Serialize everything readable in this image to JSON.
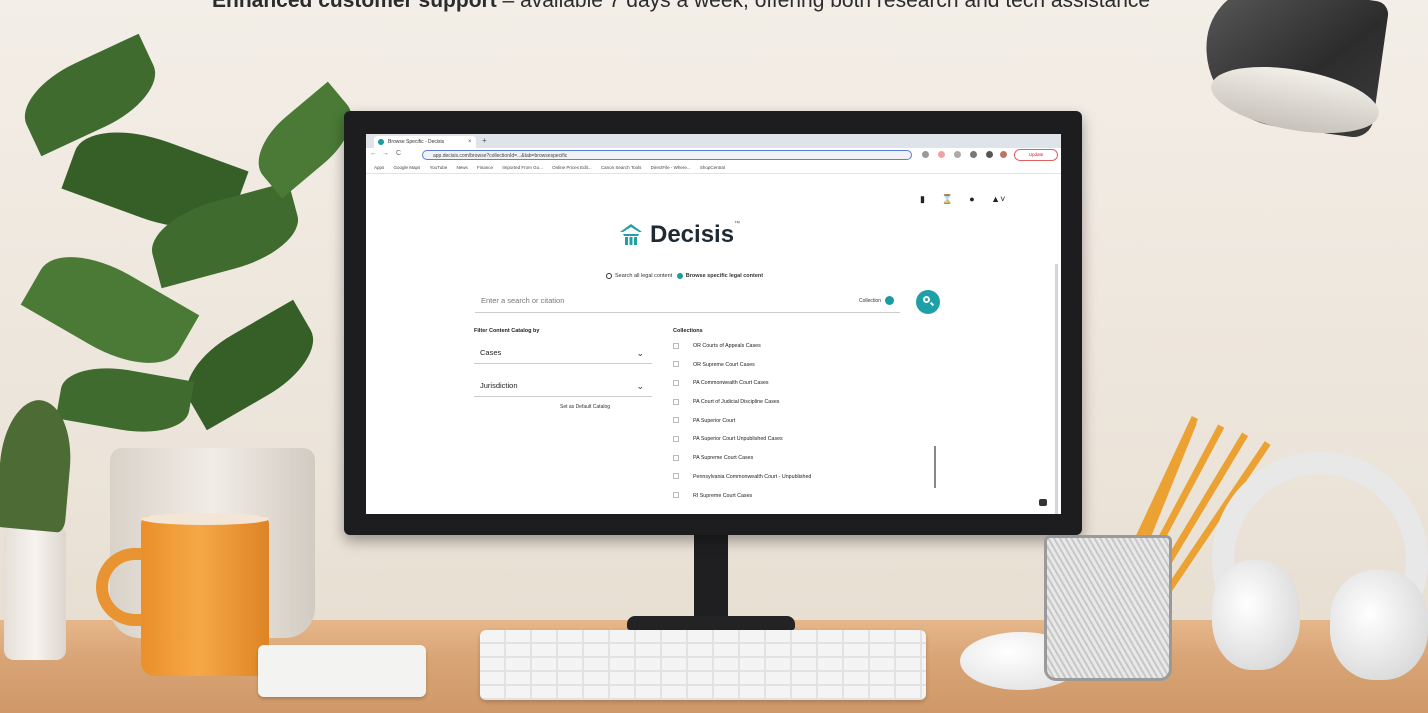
{
  "promo": {
    "headline_bold": "Enhanced customer support",
    "headline_rest": " – available 7 days a week, offering both research and tech assistance"
  },
  "browser": {
    "tab_title": "Browse Specific - Decisis",
    "tab_close": "×",
    "tab_new": "+",
    "back": "←",
    "forward": "→",
    "reload": "C",
    "url": "app.decisis.com/browse?collectionId=...&tab=browsespecific",
    "update_button": "Update",
    "bookmarks": [
      "Apps",
      "Google Maps",
      "YouTube",
      "News",
      "Finance",
      "Imported From Go...",
      "Online Prices Edit...",
      "Canon Search Tools",
      "DirectFile - Where...",
      "ShopCentral"
    ]
  },
  "app": {
    "header_icons": [
      "bookmark-icon",
      "hourglass-icon",
      "help-icon",
      "user-icon"
    ],
    "logo_text": "Decisis",
    "logo_tm": "™",
    "search_mode": {
      "option_all": "Search all legal content",
      "option_specific": "Browse specific legal content",
      "selected": "specific"
    },
    "search": {
      "placeholder": "Enter a search or citation",
      "collection_label": "Collection"
    },
    "filter": {
      "heading": "Filter Content Catalog by",
      "type_value": "Cases",
      "jurisdiction_value": "Jurisdiction",
      "default_link": "Set as Default Catalog"
    },
    "collections": {
      "heading": "Collections",
      "items": [
        "OR Courts of Appeals Cases",
        "OR Supreme Court Cases",
        "PA Commonwealth Court Cases",
        "PA Court of Judicial Discipline Cases",
        "PA Superior Court",
        "PA Superior Court Unpublished Cases",
        "PA Supreme Court Cases",
        "Pennsylvania Commonwealth Court - Unpublished",
        "RI Supreme Court Cases"
      ]
    }
  },
  "colors": {
    "accent": "#1fa0a8",
    "mug": "#f0a040",
    "pencil": "#eba233"
  }
}
